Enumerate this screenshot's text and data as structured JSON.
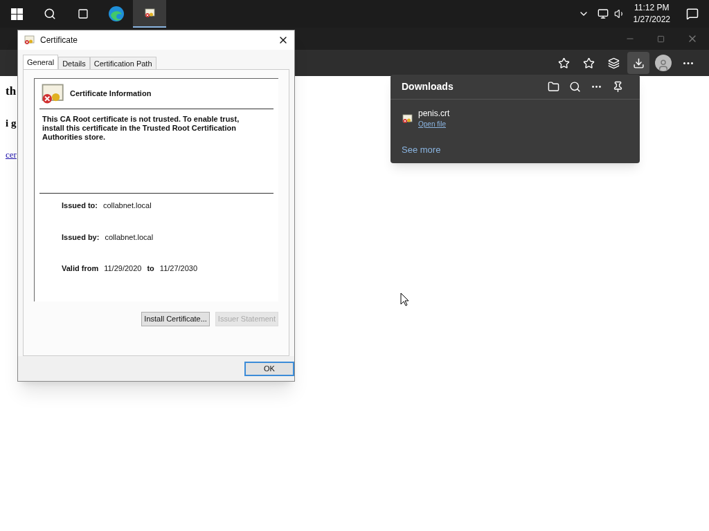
{
  "taskbar": {
    "apps": [
      {
        "kind": "edge",
        "selected": false
      },
      {
        "kind": "certificate",
        "selected": true
      }
    ],
    "time": "11:12 PM",
    "date": "1/27/2022"
  },
  "browser": {
    "toolbar": [
      {
        "kind": "favorite-add",
        "selected": false
      },
      {
        "kind": "favorites",
        "selected": false
      },
      {
        "kind": "collections",
        "selected": false
      },
      {
        "kind": "downloads",
        "selected": true
      },
      {
        "kind": "profile",
        "selected": false
      },
      {
        "kind": "more",
        "selected": false
      }
    ]
  },
  "page": {
    "lines": [
      {
        "kind": "heading",
        "text": "th"
      },
      {
        "kind": "bold",
        "text": "i g"
      },
      {
        "kind": "link",
        "text": "cer"
      }
    ]
  },
  "dialog": {
    "title": "Certificate",
    "tabs": [
      {
        "label": "General",
        "selected": true
      },
      {
        "label": "Details",
        "selected": false
      },
      {
        "label": "Certification Path",
        "selected": false
      }
    ],
    "info_title": "Certificate Information",
    "message": "This CA Root certificate is not trusted. To enable trust, install this certificate in the Trusted Root Certification Authorities store.",
    "fields": [
      {
        "label": "Issued to:",
        "value": "collabnet.local"
      },
      {
        "label": "Issued by:",
        "value": "collabnet.local"
      }
    ],
    "valid": {
      "label": "Valid from",
      "from": "11/29/2020",
      "to_label": "to",
      "to": "11/27/2030"
    },
    "buttons": [
      {
        "label": "Install Certificate...",
        "disabled": false
      },
      {
        "label": "Issuer Statement",
        "disabled": true
      }
    ],
    "ok": "OK"
  },
  "downloads": {
    "title": "Downloads",
    "items": [
      {
        "name": "penis.crt",
        "action": "Open file"
      }
    ],
    "see_more": "See more"
  }
}
